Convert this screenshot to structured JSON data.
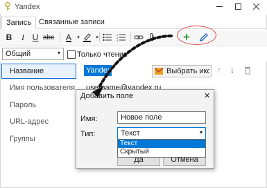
{
  "window": {
    "title": "Yandex"
  },
  "tabs": [
    {
      "label": "Запись"
    },
    {
      "label": "Связанные записи"
    }
  ],
  "toolbar": {
    "bold": "B",
    "italic": "I",
    "underline": "U",
    "strike": "abc",
    "font_color": "A",
    "add_icon": "+",
    "add_color": "#3a9a3a",
    "edit_color": "#1e64c8"
  },
  "format_row": {
    "style_value": "Общий",
    "readonly_label": "Только чтение"
  },
  "fields": [
    {
      "label": "Название",
      "value": "Yandex",
      "selected": true
    },
    {
      "label": "Имя пользователя",
      "value": "username@yandex.ru"
    },
    {
      "label": "Пароль",
      "value": ""
    },
    {
      "label": "URL-адрес",
      "value": ""
    },
    {
      "label": "Группы",
      "value": ""
    }
  ],
  "icon_button": {
    "label": "Выбрать икон"
  },
  "dialog": {
    "title": "Добавить поле",
    "name_label": "Имя:",
    "name_value": "Новое поле",
    "type_label": "Тип:",
    "type_value": "Текст",
    "type_options": [
      "Текст",
      "Скрытый"
    ],
    "ok_label": "Да",
    "cancel_label": "Отмена"
  },
  "colors": {
    "accent": "#0078d7",
    "highlight": "#e04848"
  }
}
